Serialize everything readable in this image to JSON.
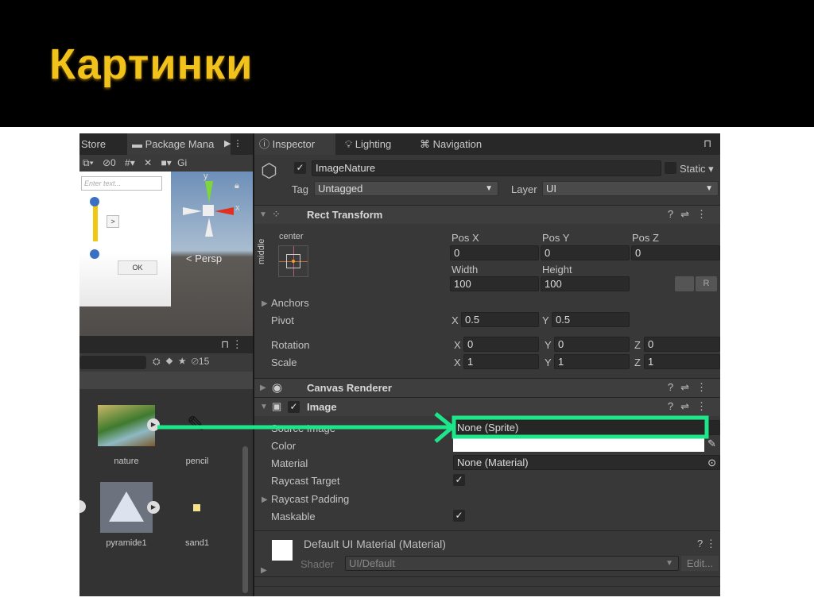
{
  "slide": {
    "title": "Картинки"
  },
  "left_panel": {
    "tabs": [
      "Store",
      "Package Mana"
    ],
    "toolbar": {
      "hidden_count": "0",
      "gizmos_label": "Gi"
    },
    "scene": {
      "input_placeholder": "Enter text...",
      "button_arrow": ">",
      "button_ok": "OK",
      "persp_label": "< Persp",
      "axis_x": "x",
      "axis_y": "y"
    },
    "project": {
      "hidden_count": "15"
    },
    "assets": [
      {
        "name": "nature"
      },
      {
        "name": "pencil"
      },
      {
        "name": "pyramide1"
      },
      {
        "name": "sand1"
      }
    ]
  },
  "inspector": {
    "tabs": [
      "Inspector",
      "Lighting",
      "Navigation"
    ],
    "object_name": "ImageNature",
    "active": true,
    "static_label": "Static",
    "tag_label": "Tag",
    "tag_value": "Untagged",
    "layer_label": "Layer",
    "layer_value": "UI",
    "rect_transform": {
      "title": "Rect Transform",
      "anchor_h": "center",
      "anchor_v": "middle",
      "pos_x_label": "Pos X",
      "pos_y_label": "Pos Y",
      "pos_z_label": "Pos Z",
      "pos_x": "0",
      "pos_y": "0",
      "pos_z": "0",
      "width_label": "Width",
      "height_label": "Height",
      "width": "100",
      "height": "100",
      "r_button": "R",
      "anchors_label": "Anchors",
      "pivot_label": "Pivot",
      "pivot_x": "0.5",
      "pivot_y": "0.5",
      "rotation_label": "Rotation",
      "rot_x": "0",
      "rot_y": "0",
      "rot_z": "0",
      "scale_label": "Scale",
      "scale_x": "1",
      "scale_y": "1",
      "scale_z": "1",
      "x": "X",
      "y": "Y",
      "z": "Z"
    },
    "canvas_renderer": {
      "title": "Canvas Renderer"
    },
    "image": {
      "title": "Image",
      "enabled": true,
      "source_image_label": "Source Image",
      "source_image_value": "None (Sprite)",
      "color_label": "Color",
      "color_value": "#ffffff",
      "material_label": "Material",
      "material_value": "None (Material)",
      "raycast_target_label": "Raycast Target",
      "raycast_target": true,
      "raycast_padding_label": "Raycast Padding",
      "maskable_label": "Maskable",
      "maskable": true
    },
    "material": {
      "title": "Default UI Material (Material)",
      "shader_label": "Shader",
      "shader_value": "UI/Default",
      "edit_button": "Edit..."
    }
  },
  "colors": {
    "highlight": "#1de58a",
    "title": "#f2c21c",
    "panel": "#383838"
  }
}
